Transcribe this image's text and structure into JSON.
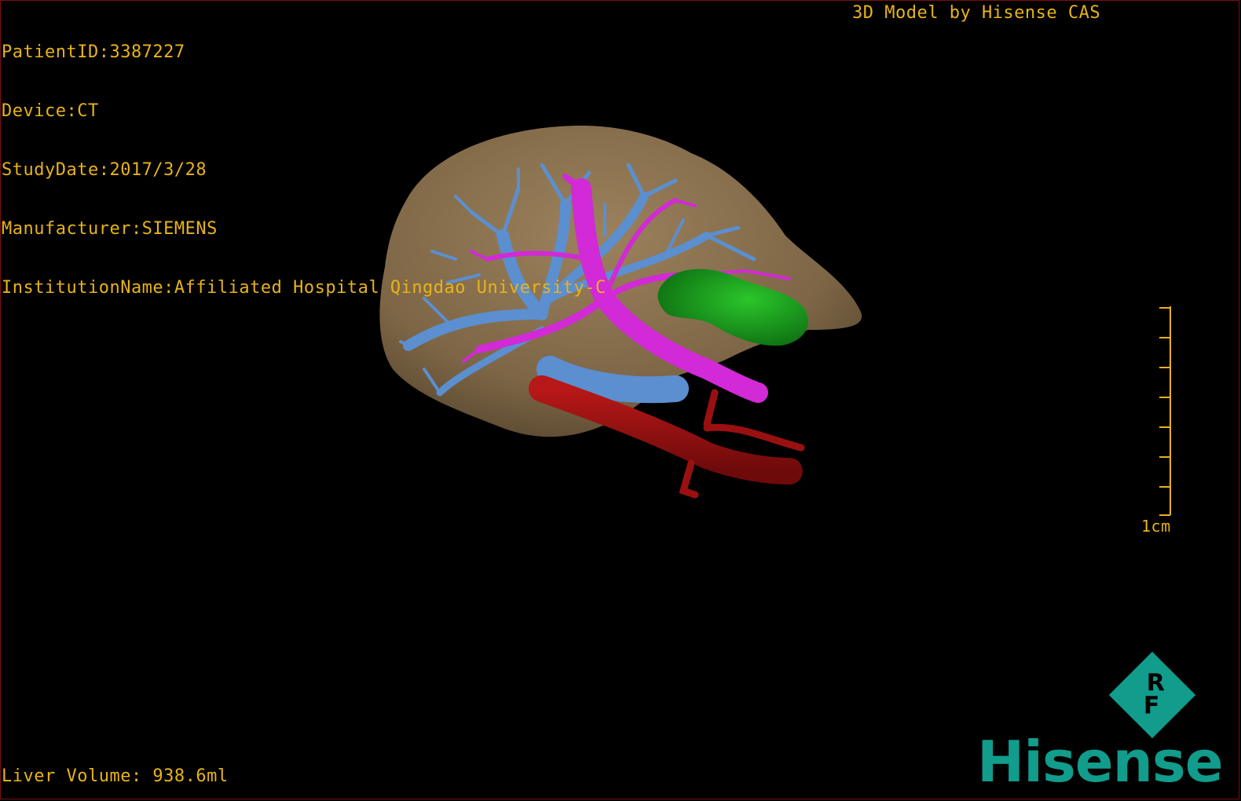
{
  "patient_info": {
    "patient_id": "PatientID:3387227",
    "device": "Device:CT",
    "study_date": "StudyDate:2017/3/28",
    "manufacturer": "Manufacturer:SIEMENS",
    "institution": "InstitutionName:Affiliated Hospital Qingdao University-C"
  },
  "credit": "3D Model by Hisense CAS",
  "liver_volume": "Liver Volume: 938.6ml",
  "scale_bar": {
    "label": "1cm",
    "ticks": 7
  },
  "brand": {
    "word": "Hisense",
    "badge_letters": [
      "R",
      "F"
    ]
  },
  "colors": {
    "hud_text": "#e8b318",
    "liver": "#8a7150",
    "portal_vein": "#5b8fd0",
    "hepatic_artery": "#d12ad6",
    "gallbladder": "#16931a",
    "vena_cava": "#a01414",
    "brand": "#119c8c"
  },
  "structures": [
    "liver-model",
    "portal-vein-tree",
    "hepatic-vein-tree",
    "gallbladder-model",
    "vena-cava-model"
  ]
}
